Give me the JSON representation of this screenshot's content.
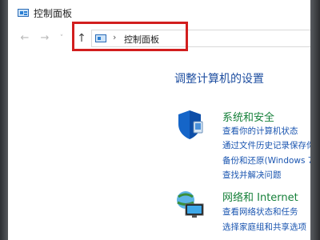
{
  "window": {
    "title": "控制面板"
  },
  "nav": {
    "back_glyph": "←",
    "forward_glyph": "→",
    "recent_glyph": "˅",
    "up_glyph": "↑"
  },
  "address": {
    "separator": "›",
    "path": "控制面板"
  },
  "main": {
    "heading": "调整计算机的设置",
    "categories": [
      {
        "title": "系统和安全",
        "icon": "shield-icon",
        "links": [
          "查看你的计算机状态",
          "通过文件历史记录保存你",
          "备份和还原(Windows 7",
          "查找并解决问题"
        ]
      },
      {
        "title": "网络和 Internet",
        "icon": "network-icon",
        "links": [
          "查看网络状态和任务",
          "选择家庭组和共享选项"
        ]
      }
    ]
  },
  "colors": {
    "accent_blue": "#1e4ea0",
    "link_blue": "#1a55b0",
    "category_green": "#16803a",
    "highlight_red": "#d21e1e"
  }
}
